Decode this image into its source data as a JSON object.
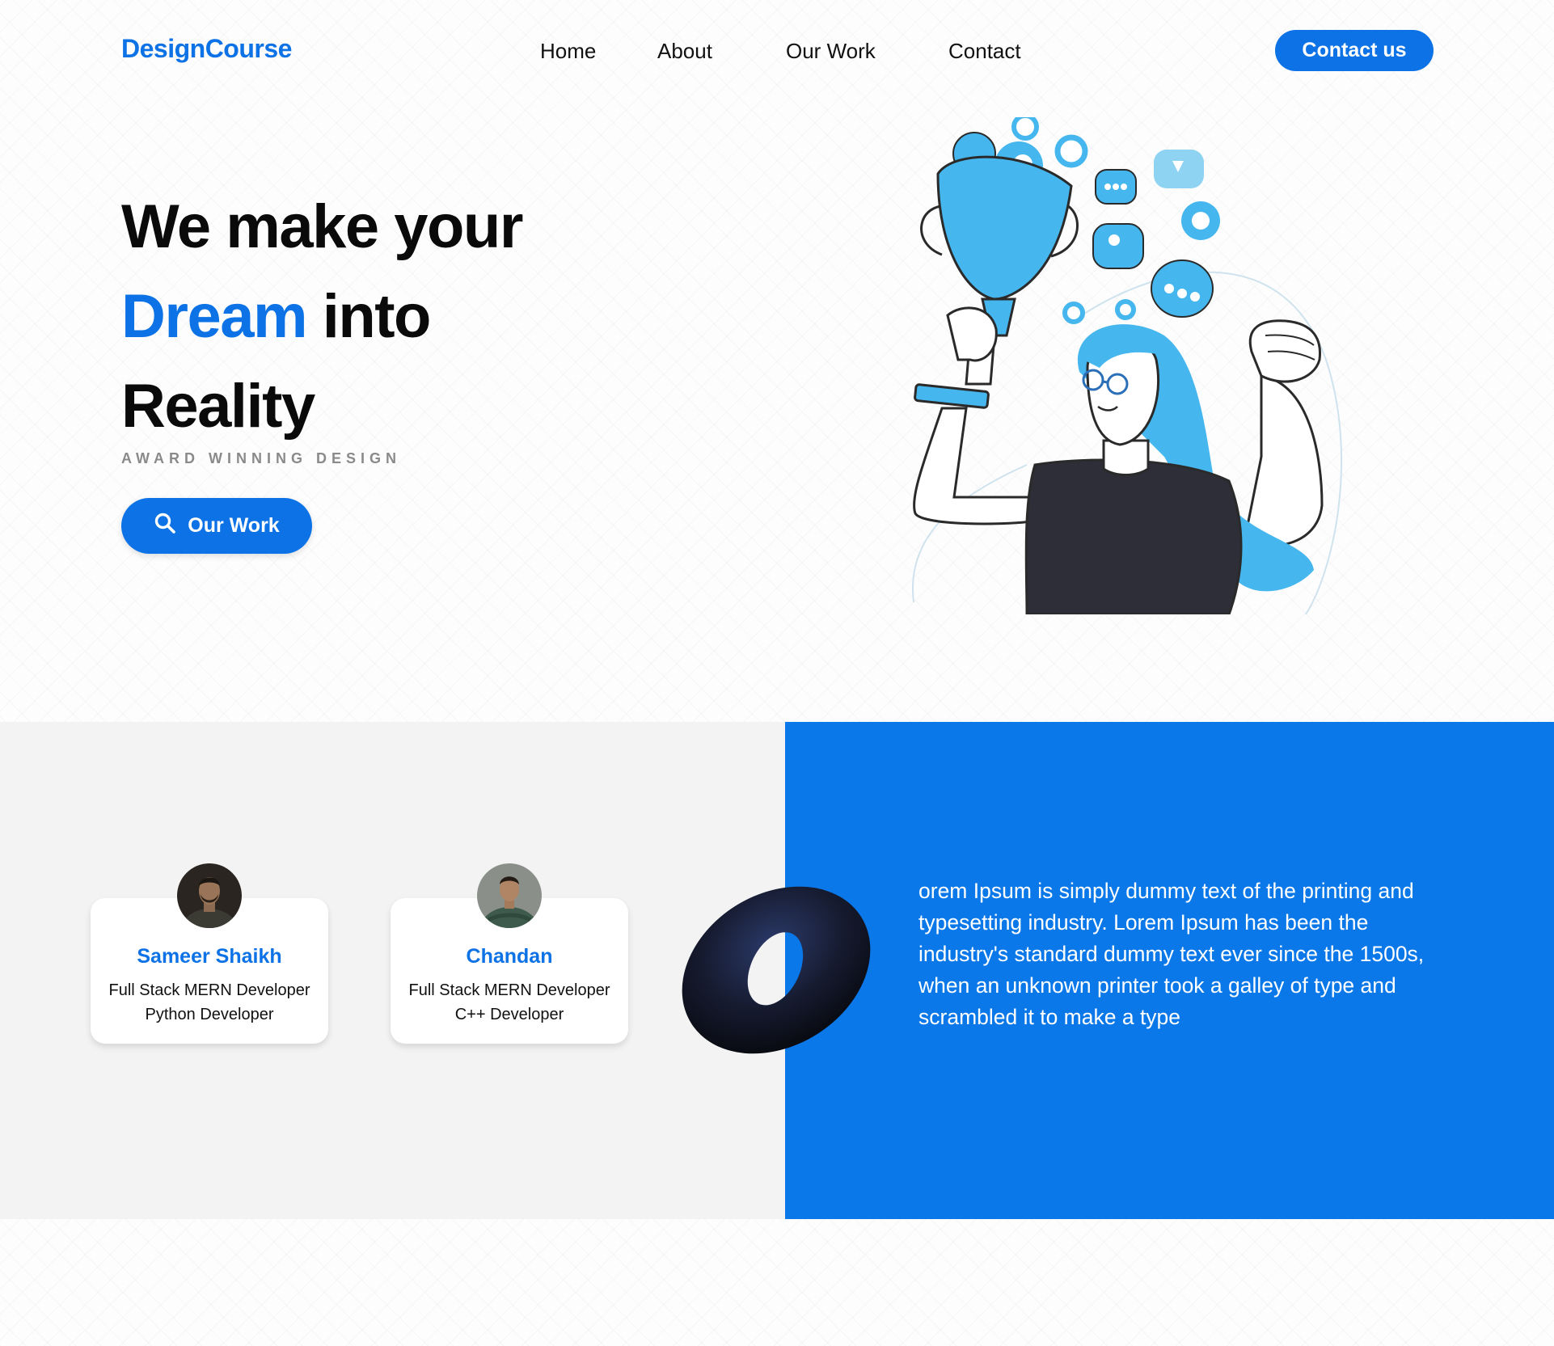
{
  "nav": {
    "logo": "DesignCourse",
    "links": [
      "Home",
      "About",
      "Our Work",
      "Contact"
    ],
    "cta_label": "Contact us"
  },
  "hero": {
    "title_line1": "We make your",
    "title_highlight": "Dream",
    "title_line2_rest": "into",
    "title_line3": "Reality",
    "tagline": "AWARD WINNING DESIGN",
    "button_label": "Our Work",
    "button_icon": "search-icon",
    "illustration": "person-holding-trophy-illustration"
  },
  "team": [
    {
      "name": "Sameer Shaikh",
      "role1": "Full Stack MERN Developer",
      "role2": "Python Developer"
    },
    {
      "name": "Chandan",
      "role1": "Full Stack MERN Developer",
      "role2": "C++ Developer"
    }
  ],
  "about": {
    "paragraph": "orem Ipsum is simply dummy text of the printing and typesetting industry. Lorem Ipsum has been the industry's standard dummy text ever since the 1500s, when an unknown printer took a galley of type and scrambled it to make a type"
  },
  "colors": {
    "accent": "#0c72e6",
    "panel_blue": "#0a78e8",
    "panel_gray": "#f3f3f3",
    "illustration_blue": "#45b7ee",
    "shirt": "#2e2e38"
  }
}
